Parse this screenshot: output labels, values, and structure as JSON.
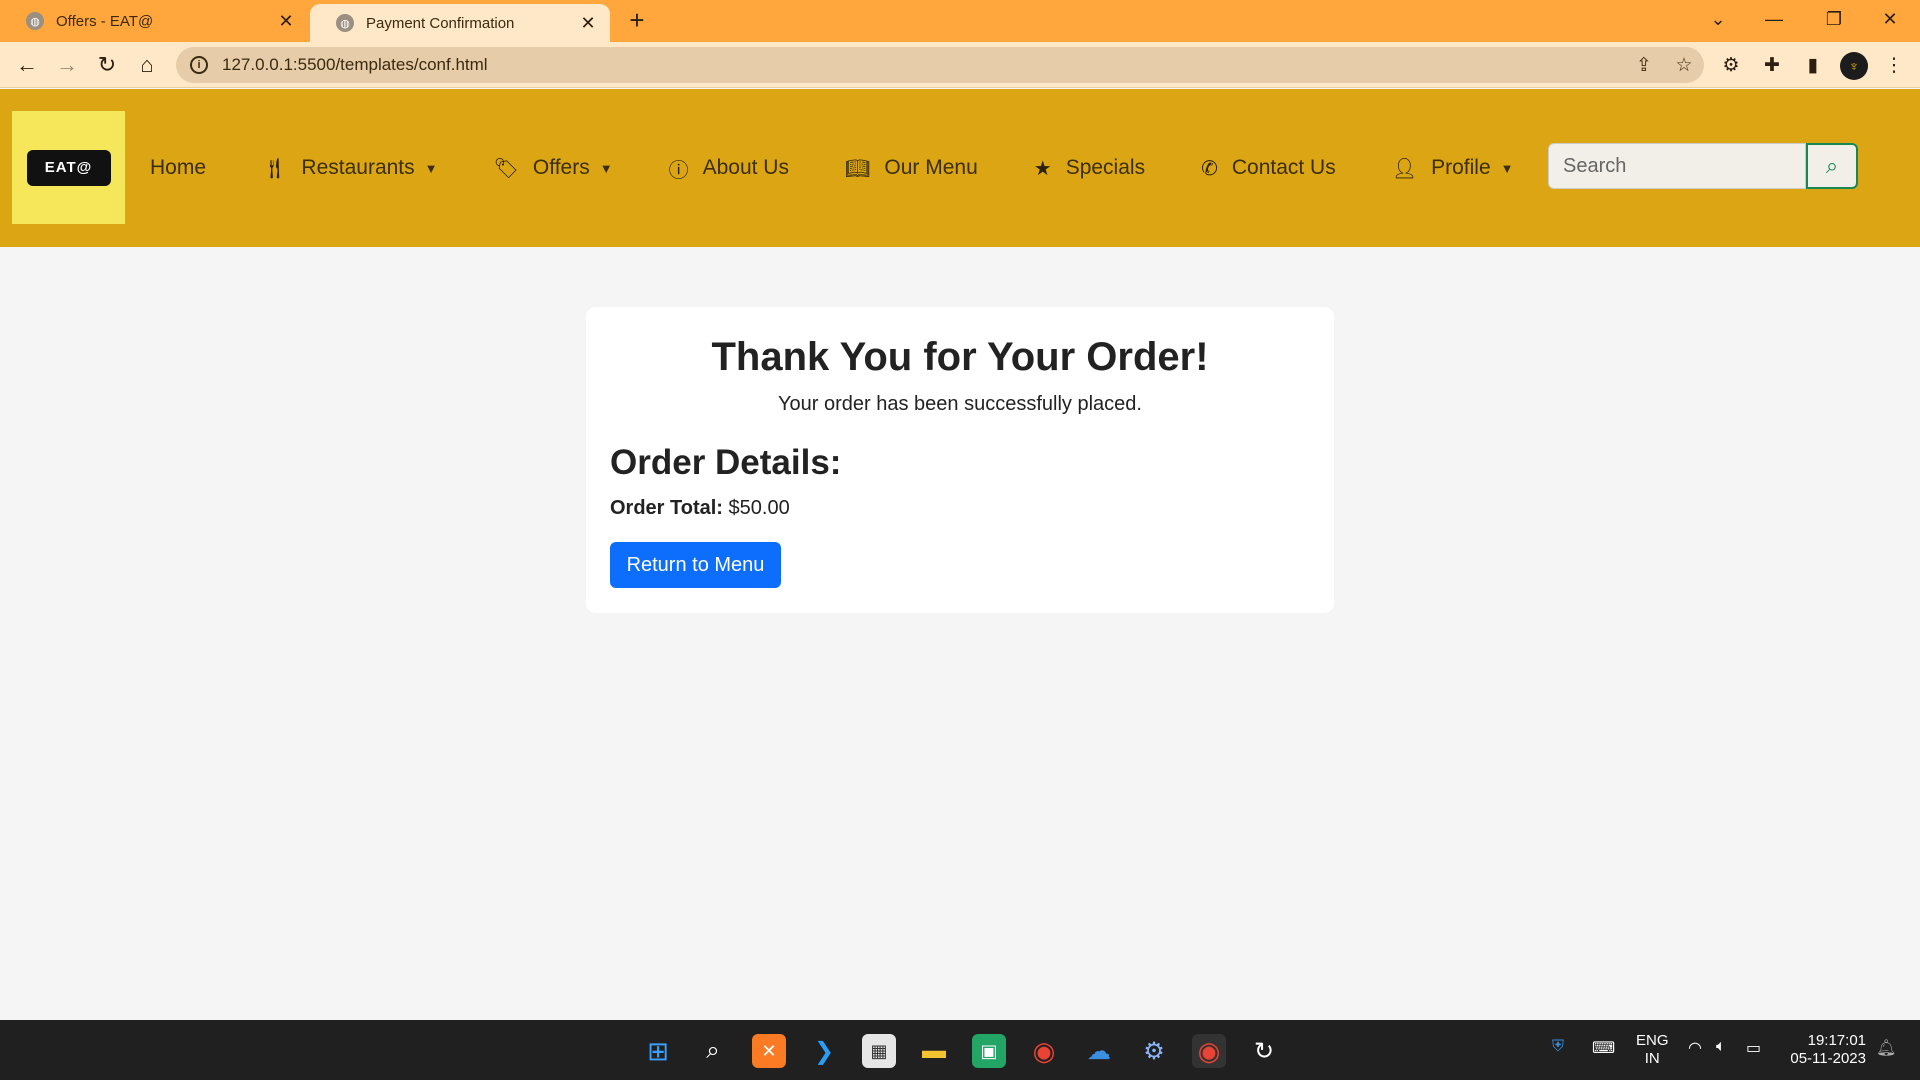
{
  "browser": {
    "tabs": [
      {
        "title": "Offers - EAT@"
      },
      {
        "title": "Payment Confirmation"
      }
    ],
    "url": "127.0.0.1:5500/templates/conf.html"
  },
  "site": {
    "logo_text": "EAT@",
    "nav": [
      {
        "label": "Home",
        "icon": "home"
      },
      {
        "label": "Restaurants",
        "icon": "utensils-icon"
      },
      {
        "label": "Offers",
        "icon": "tags-icon"
      },
      {
        "label": "About Us",
        "icon": "info-circle-icon"
      },
      {
        "label": "Our Menu",
        "icon": "book-open-icon"
      },
      {
        "label": "Specials",
        "icon": "star-icon"
      },
      {
        "label": "Contact Us",
        "icon": "phone-icon"
      },
      {
        "label": "Profile",
        "icon": "user-icon"
      }
    ],
    "search_placeholder": "Search"
  },
  "confirmation": {
    "heading": "Thank You for Your Order!",
    "message": "Your order has been successfully placed.",
    "details_heading": "Order Details:",
    "total_label": "Order Total:",
    "total_value": "$50.00",
    "return_button": "Return to Menu"
  },
  "taskbar": {
    "lang_line1": "ENG",
    "lang_line2": "IN",
    "time": "19:17:01",
    "date": "05-11-2023"
  },
  "colors": {
    "tabstrip": "#ffa73c",
    "navbar": "#dba514",
    "primary_button": "#0d6efd",
    "search_button": "#198754"
  }
}
